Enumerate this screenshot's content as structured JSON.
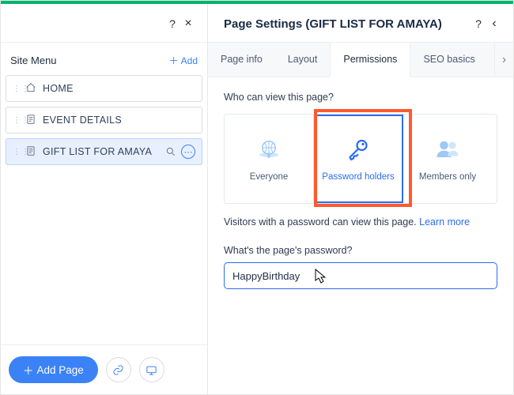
{
  "sidebar": {
    "title": "Site Menu",
    "add_label": "Add",
    "items": [
      {
        "icon": "home-icon",
        "label": "HOME"
      },
      {
        "icon": "page-icon",
        "label": "EVENT DETAILS"
      },
      {
        "icon": "page-icon",
        "label": "GIFT LIST FOR AMAYA",
        "selected": true
      }
    ],
    "add_page_label": "Add Page"
  },
  "panel": {
    "title": "Page Settings (GIFT LIST FOR AMAYA)",
    "tabs": [
      "Page info",
      "Layout",
      "Permissions",
      "SEO basics"
    ],
    "active_tab_index": 2
  },
  "permissions": {
    "question": "Who can view this page?",
    "options": [
      {
        "label": "Everyone",
        "icon": "globe-icon"
      },
      {
        "label": "Password holders",
        "icon": "key-icon",
        "selected": true
      },
      {
        "label": "Members only",
        "icon": "members-icon"
      }
    ],
    "description": "Visitors with a password can view this page.",
    "learn_more": "Learn more",
    "password_label": "What's the page's password?",
    "password_value": "HappyBirthday"
  }
}
